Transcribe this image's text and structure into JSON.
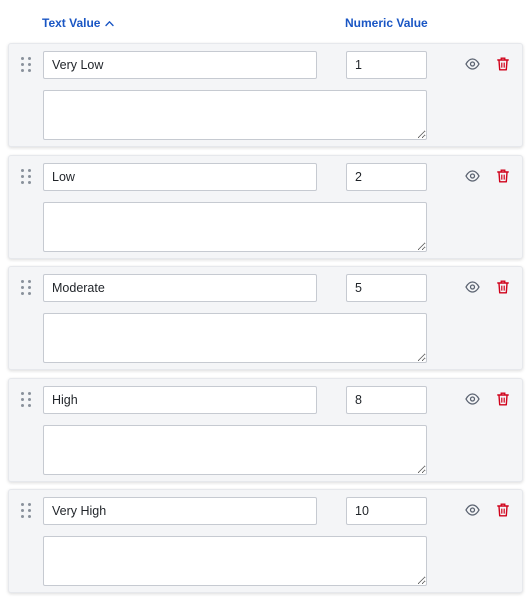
{
  "header": {
    "text_value_label": "Text Value",
    "numeric_value_label": "Numeric Value"
  },
  "sort": {
    "icon": "chevron-up-icon",
    "direction": "ascending"
  },
  "colors": {
    "header_text": "#1a56c4",
    "delete_icon": "#d0021b",
    "eye_icon": "#5a6270"
  },
  "rows": [
    {
      "text": "Very Low",
      "numeric": "1",
      "description": ""
    },
    {
      "text": "Low",
      "numeric": "2",
      "description": ""
    },
    {
      "text": "Moderate",
      "numeric": "5",
      "description": ""
    },
    {
      "text": "High",
      "numeric": "8",
      "description": ""
    },
    {
      "text": "Very High",
      "numeric": "10",
      "description": ""
    }
  ]
}
